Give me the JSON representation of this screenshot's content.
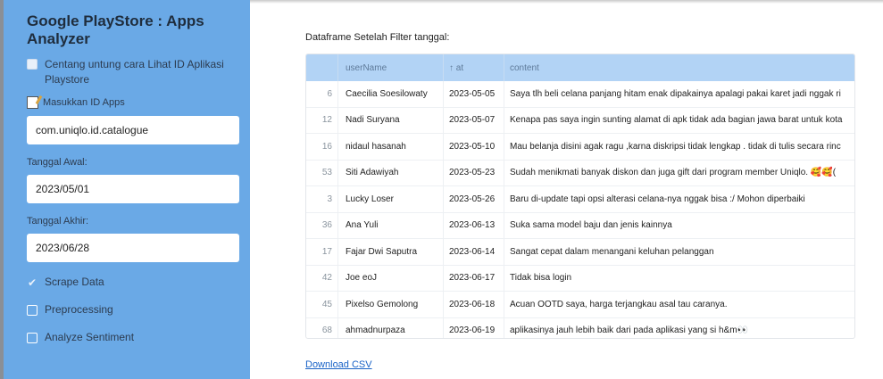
{
  "sidebar": {
    "title": "Google PlayStore : Apps Analyzer",
    "checkbox_label": "Centang untung cara Lihat ID Aplikasi Playstore",
    "app_id_label": "Masukkan ID Apps",
    "app_id_value": "com.uniqlo.id.catalogue",
    "start_label": "Tanggal Awal:",
    "start_value": "2023/05/01",
    "end_label": "Tanggal Akhir:",
    "end_value": "2023/06/28",
    "nav": [
      {
        "label": "Scrape Data",
        "checked": true
      },
      {
        "label": "Preprocessing",
        "checked": false
      },
      {
        "label": "Analyze Sentiment",
        "checked": false
      }
    ]
  },
  "main": {
    "caption": "Dataframe Setelah Filter tanggal:",
    "columns": {
      "user": "userName",
      "at": "↑ at",
      "content": "content"
    },
    "rows": [
      {
        "idx": "6",
        "user": "Caecilia Soesilowaty",
        "at": "2023-05-05",
        "content": "Saya tlh beli celana panjang hitam enak dipakainya apalagi pakai karet jadi nggak ri"
      },
      {
        "idx": "12",
        "user": "Nadi Suryana",
        "at": "2023-05-07",
        "content": "Kenapa pas saya ingin sunting alamat di apk tidak ada bagian jawa barat untuk kota"
      },
      {
        "idx": "16",
        "user": "nidaul hasanah",
        "at": "2023-05-10",
        "content": "Mau belanja disini agak ragu ,karna diskripsi tidak lengkap . tidak di tulis secara rinc"
      },
      {
        "idx": "53",
        "user": "Siti Adawiyah",
        "at": "2023-05-23",
        "content": "Sudah menikmati banyak diskon dan juga gift dari program member Uniqlo. 🥰🥰("
      },
      {
        "idx": "3",
        "user": "Lucky Loser",
        "at": "2023-05-26",
        "content": "Baru di-update tapi opsi alterasi celana-nya nggak bisa :/ Mohon diperbaiki"
      },
      {
        "idx": "36",
        "user": "Ana Yuli",
        "at": "2023-06-13",
        "content": "Suka sama model baju dan jenis kainnya"
      },
      {
        "idx": "17",
        "user": "Fajar Dwi Saputra",
        "at": "2023-06-14",
        "content": "Sangat cepat dalam menangani keluhan pelanggan"
      },
      {
        "idx": "42",
        "user": "Joe eoJ",
        "at": "2023-06-17",
        "content": "Tidak bisa login"
      },
      {
        "idx": "45",
        "user": "Pixelso Gemolong",
        "at": "2023-06-18",
        "content": "Acuan OOTD saya, harga terjangkau asal tau caranya."
      },
      {
        "idx": "68",
        "user": "ahmadnurpaza",
        "at": "2023-06-19",
        "content": "aplikasinya jauh lebih baik dari pada aplikasi yang si h&m👀"
      }
    ],
    "download_label": "Download CSV"
  }
}
